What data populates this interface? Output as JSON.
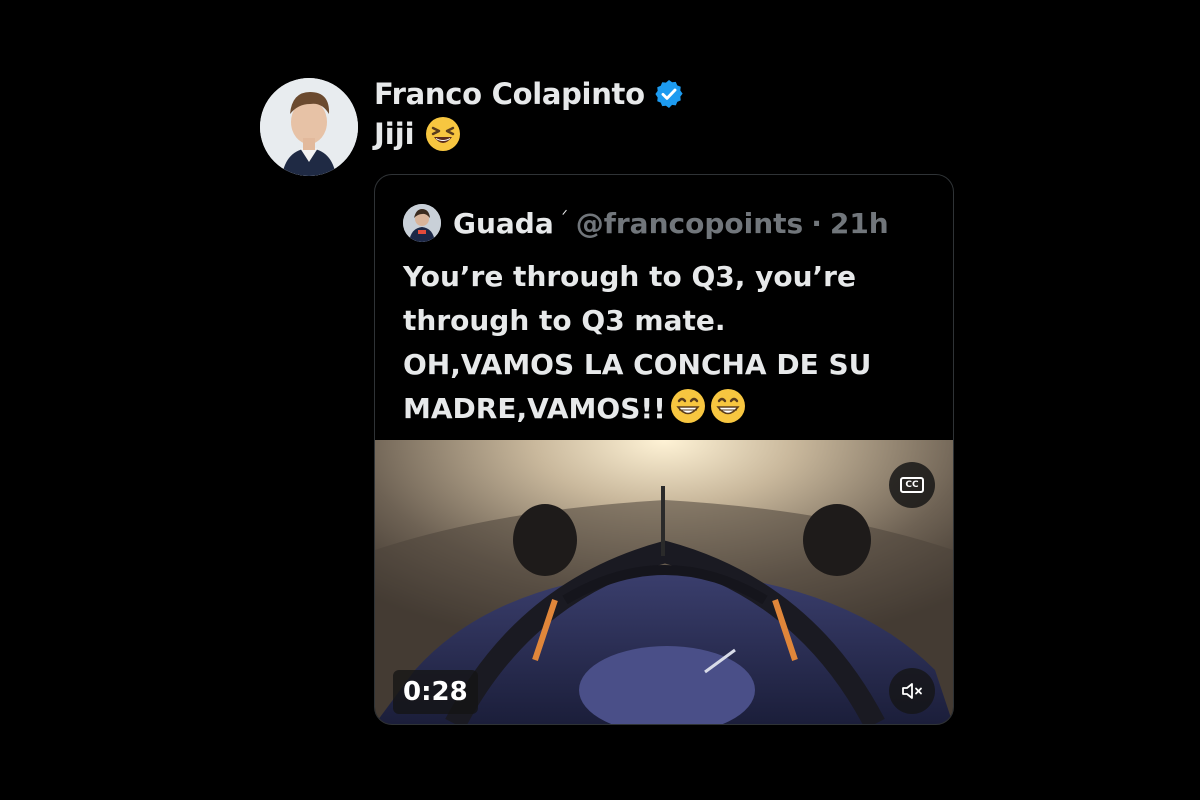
{
  "tweet": {
    "author_name": "Franco Colapinto",
    "verified": true,
    "text": "Jiji",
    "text_emoji": "laughing-face"
  },
  "quote": {
    "name": "Guada",
    "name_mark": "ᐟ",
    "handle": "@francopoints",
    "separator": "·",
    "time_ago": "21h",
    "lines": [
      "You’re through to Q3, you’re",
      "through to Q3 mate.",
      "OH,VAMOS LA CONCHA DE SU",
      "MADRE,VAMOS!!"
    ],
    "end_emojis": [
      "grinning-face",
      "grinning-face"
    ]
  },
  "video": {
    "duration": "0:28",
    "cc_label": "CC",
    "muted": true
  },
  "colors": {
    "background": "#000000",
    "text": "#e7e9ea",
    "secondary_text": "#71767b",
    "verified_blue": "#1d9bf0",
    "card_border": "#2f3336"
  }
}
